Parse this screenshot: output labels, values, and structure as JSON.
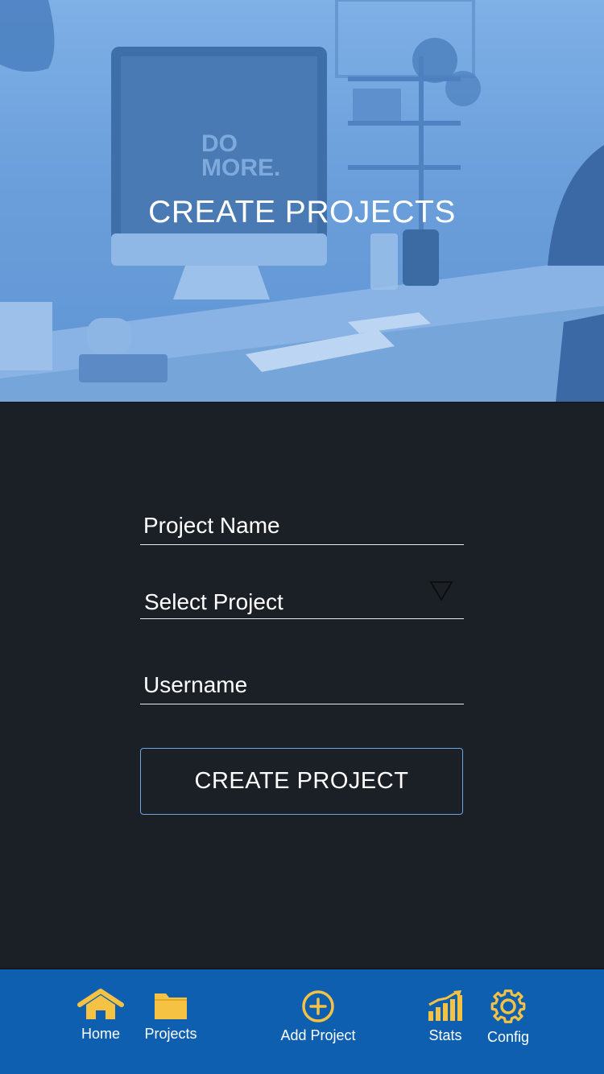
{
  "hero": {
    "title": "CREATE PROJECTS",
    "monitor_text_line1": "DO",
    "monitor_text_line2": "MORE."
  },
  "form": {
    "project_name_placeholder": "Project Name",
    "select_project_label": "Select Project",
    "username_placeholder": "Username",
    "submit_label": "CREATE PROJECT"
  },
  "tabbar": {
    "items": [
      {
        "label": "Home",
        "icon": "home-icon"
      },
      {
        "label": "Projects",
        "icon": "folder-icon"
      },
      {
        "label": "Add Project",
        "icon": "plus-circle-icon"
      },
      {
        "label": "Stats",
        "icon": "bar-chart-icon"
      },
      {
        "label": "Config",
        "icon": "gear-icon"
      }
    ]
  },
  "colors": {
    "background": "#1b1f26",
    "hero_tint": "#6b9fdb",
    "tabbar": "#0e5fb0",
    "icon_accent": "#f5c243",
    "button_border": "#6ea5e0",
    "text": "#ffffff"
  }
}
